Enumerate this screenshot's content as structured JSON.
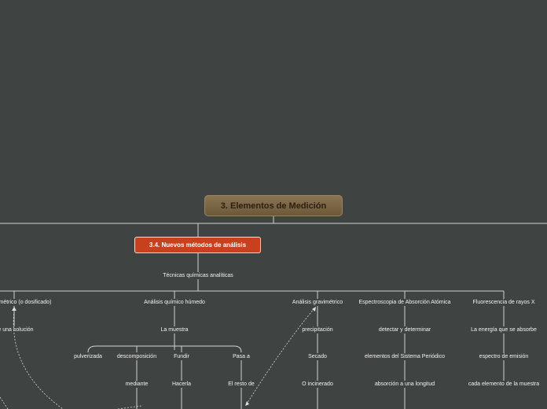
{
  "root": {
    "label": "3. Elementos de Medición"
  },
  "main_topic": {
    "label": "3.4. Nuevos métodos de análisis"
  },
  "subtopic": {
    "label": "Técnicas químicas analíticas"
  },
  "volumetric": {
    "label": "umétrico (o dosificado)",
    "child": "e una solución"
  },
  "humid": {
    "label": "Análisis químico húmedo",
    "child": "La muestra",
    "branches": [
      "pulverizada",
      "descomposición",
      "Fundir",
      "Pasa a"
    ],
    "sub": {
      "descomposicion": "mediante",
      "fundir": "Hacerla",
      "pasa": "El resto de"
    }
  },
  "gravimetric": {
    "label": "Análisis gravimétrico",
    "steps": [
      "precipitación",
      "Secado",
      "O incinerado"
    ]
  },
  "atomic": {
    "label": "Espectroscopia de Absorción Atómica",
    "steps": [
      "detectar y determinar",
      "elementos del Sistema Periódico",
      "absorción a una longitud"
    ]
  },
  "xray": {
    "label": "Fluorescencia de rayos X",
    "steps": [
      "La energía que se absorbe",
      "espectro de emisión",
      "cada elemento de la muestra"
    ]
  },
  "colors": {
    "background": "#3f4443",
    "root": "#7a6545",
    "main": "#c8401d",
    "line": "#d8d8d8"
  }
}
